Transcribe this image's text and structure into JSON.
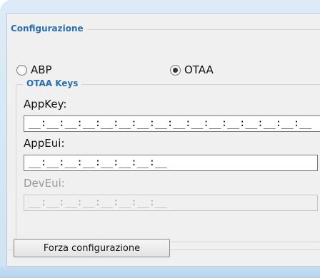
{
  "config": {
    "legend": "Configurazione",
    "radio_abp": {
      "label": "ABP",
      "checked": false
    },
    "radio_otaa": {
      "label": "OTAA",
      "checked": true
    }
  },
  "otaa_keys": {
    "legend": "OTAA Keys",
    "appkey": {
      "label": "AppKey:",
      "value": "__:__:__:__:__:__:__:__:__:__:__:__:__:__:__:__"
    },
    "appeui": {
      "label": "AppEui:",
      "value": "__:__:__:__:__:__:__:__"
    },
    "deveui": {
      "label": "DevEui:",
      "value": "__:__:__:__:__:__:__:__",
      "disabled": true
    }
  },
  "actions": {
    "force_config_label": "Forza configurazione"
  },
  "colors": {
    "accent": "#2a6fb0",
    "frame": "#cfe3f3",
    "panel": "#f0f0f0"
  }
}
